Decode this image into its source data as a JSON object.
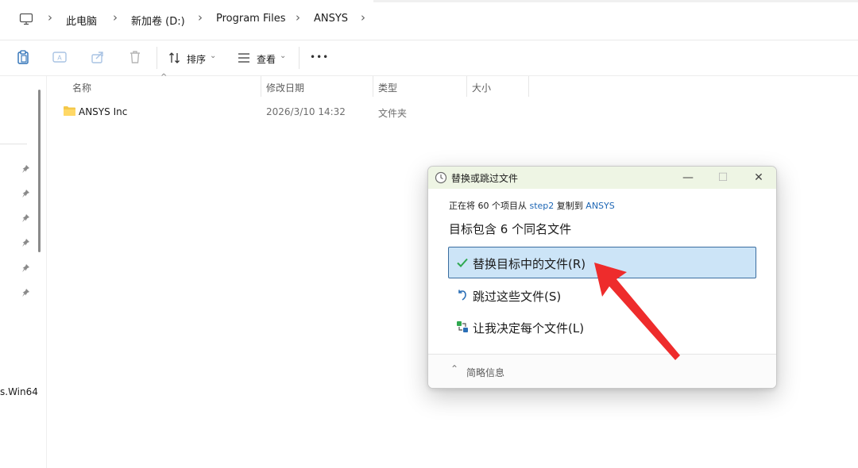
{
  "breadcrumb": {
    "items": [
      "此电脑",
      "新加卷 (D:)",
      "Program Files",
      "ANSYS"
    ]
  },
  "toolbar": {
    "sort_label": "排序",
    "view_label": "查看",
    "more_label": "•••"
  },
  "nav": {
    "partial_item": "s.Win64"
  },
  "file_list": {
    "columns": [
      "名称",
      "修改日期",
      "类型",
      "大小"
    ],
    "rows": [
      {
        "name": "ANSYS Inc",
        "modified": "2026/3/10 14:32",
        "type": "文件夹",
        "size": ""
      }
    ]
  },
  "dialog": {
    "title": "替换或跳过文件",
    "info_prefix": "正在将 60 个项目从",
    "info_source": "step2",
    "info_middle": "复制到",
    "info_target": "ANSYS",
    "heading": "目标包含 6 个同名文件",
    "options": [
      {
        "label": "替换目标中的文件(R)",
        "icon": "check-icon",
        "selected": true
      },
      {
        "label": "跳过这些文件(S)",
        "icon": "skip-undo-icon",
        "selected": false
      },
      {
        "label": "让我决定每个文件(L)",
        "icon": "decide-icon",
        "selected": false
      }
    ],
    "details_label": "简略信息",
    "minimize_label": "—",
    "maximize_label": "☐",
    "close_label": "✕"
  },
  "colors": {
    "selection": "#cce4f7",
    "selection_border": "#3a6d9f",
    "title_bar": "#eef5e4",
    "link": "#1d66b5",
    "annotation_arrow": "#ee2c2c"
  }
}
